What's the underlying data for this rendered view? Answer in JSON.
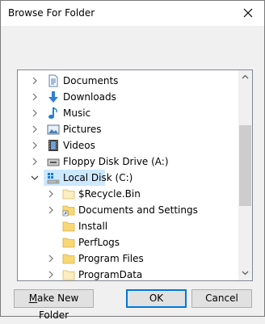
{
  "window": {
    "title": "Browse For Folder"
  },
  "tree": {
    "items": [
      {
        "label": "Documents",
        "icon": "documents-icon"
      },
      {
        "label": "Downloads",
        "icon": "downloads-icon"
      },
      {
        "label": "Music",
        "icon": "music-icon"
      },
      {
        "label": "Pictures",
        "icon": "pictures-icon"
      },
      {
        "label": "Videos",
        "icon": "videos-icon"
      },
      {
        "label": "Floppy Disk Drive (A:)",
        "icon": "floppy-drive-icon"
      },
      {
        "label": "Local Disk (C:)",
        "icon": "local-disk-icon",
        "expanded": true,
        "selected": true
      },
      {
        "label": "$Recycle.Bin",
        "icon": "folder-icon"
      },
      {
        "label": "Documents and Settings",
        "icon": "folder-shortcut-icon"
      },
      {
        "label": "Install",
        "icon": "folder-icon"
      },
      {
        "label": "PerfLogs",
        "icon": "folder-icon"
      },
      {
        "label": "Program Files",
        "icon": "folder-icon"
      },
      {
        "label": "ProgramData",
        "icon": "folder-icon"
      }
    ]
  },
  "buttons": {
    "make_new_folder_prefix": "M",
    "make_new_folder_rest": "ake New Folder",
    "ok": "OK",
    "cancel": "Cancel"
  },
  "colors": {
    "selection": "#cce8ff",
    "folder": "#f8d775",
    "accent": "#0078d7"
  }
}
